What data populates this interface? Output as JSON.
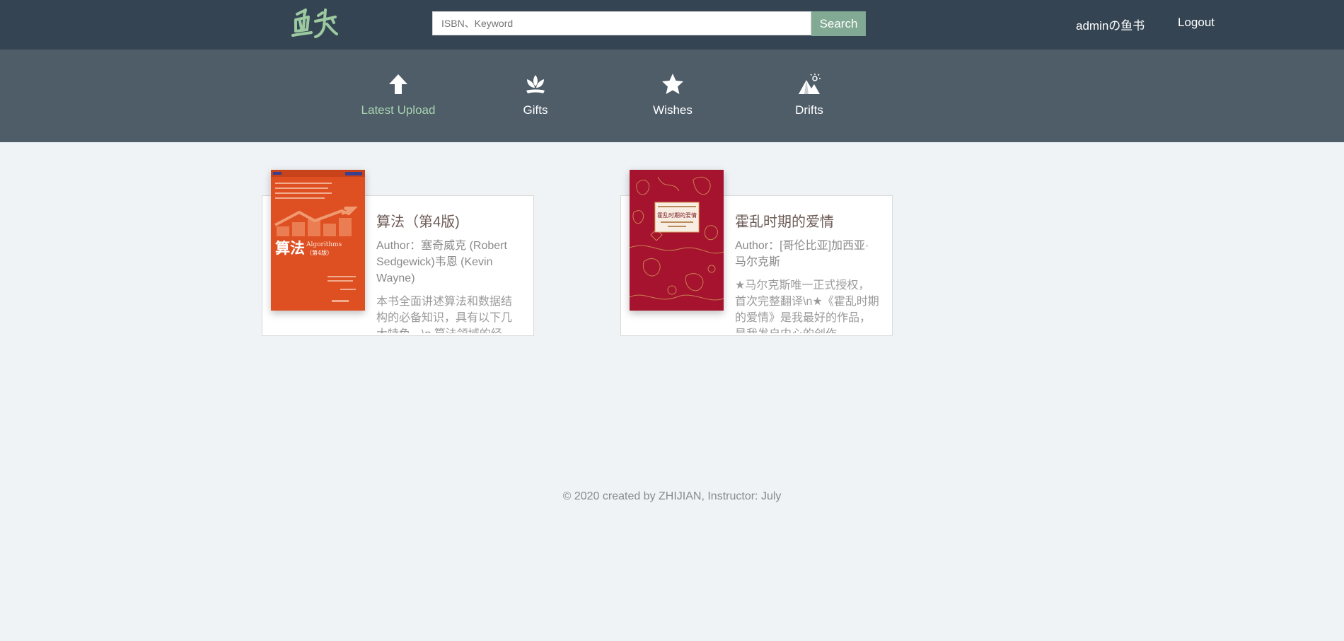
{
  "header": {
    "logo_text": "鱼书",
    "search_placeholder": "ISBN、Keyword",
    "search_button": "Search",
    "user_label": "adminの鱼书",
    "logout_label": "Logout"
  },
  "nav": {
    "items": [
      {
        "label": "Latest Upload",
        "icon": "upload-arrow-icon",
        "active": true
      },
      {
        "label": "Gifts",
        "icon": "flower-icon",
        "active": false
      },
      {
        "label": "Wishes",
        "icon": "star-icon",
        "active": false
      },
      {
        "label": "Drifts",
        "icon": "mountain-icon",
        "active": false
      }
    ]
  },
  "books": [
    {
      "title": "算法（第4版)",
      "author": "Author：塞奇威克 (Robert Sedgewick)韦恩 (Kevin Wayne)",
      "summary": "本书全面讲述算法和数据结构的必备知识，具有以下几大特色。\\n 算法领域的经",
      "cover_title": "算法",
      "cover_subtitle": "Algorithms",
      "cover_edition": "（第4版）",
      "cover_color": "#de4f22"
    },
    {
      "title": "霍乱时期的爱情",
      "author": "Author：[哥伦比亚]加西亚·马尔克斯",
      "summary": "★马尔克斯唯一正式授权，首次完整翻译\\n★《霍乱时期的爱情》是我最好的作品，是我发自内心的创作",
      "cover_title": "霍乱时期的爱情",
      "cover_color": "#a5132f"
    }
  ],
  "footer": {
    "text": "© 2020 created by ZHIJIAN, Instructor: July"
  },
  "colors": {
    "topbar": "#344452",
    "subnav": "#4f5d69",
    "accent": "#81a993",
    "active_nav": "#a7d4ae",
    "page_bg": "#eff3f6"
  }
}
